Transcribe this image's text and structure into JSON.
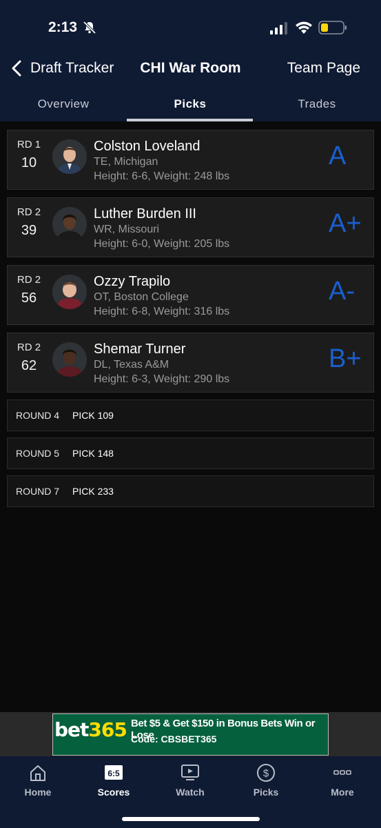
{
  "status": {
    "time": "2:13"
  },
  "nav": {
    "back_label": "Draft Tracker",
    "title": "CHI War Room",
    "right_label": "Team Page"
  },
  "tabs": [
    {
      "label": "Overview"
    },
    {
      "label": "Picks"
    },
    {
      "label": "Trades"
    }
  ],
  "picks": [
    {
      "round": "RD 1",
      "pick": "10",
      "name": "Colston Loveland",
      "position": "TE, Michigan",
      "measure": "Height: 6-6, Weight: 248 lbs",
      "grade": "A"
    },
    {
      "round": "RD 2",
      "pick": "39",
      "name": "Luther Burden III",
      "position": "WR, Missouri",
      "measure": "Height: 6-0, Weight: 205 lbs",
      "grade": "A+"
    },
    {
      "round": "RD 2",
      "pick": "56",
      "name": "Ozzy Trapilo",
      "position": "OT, Boston College",
      "measure": "Height: 6-8, Weight: 316 lbs",
      "grade": "A-"
    },
    {
      "round": "RD 2",
      "pick": "62",
      "name": "Shemar Turner",
      "position": "DL, Texas A&M",
      "measure": "Height: 6-3, Weight: 290 lbs",
      "grade": "B+"
    }
  ],
  "future_picks": [
    {
      "round": "ROUND 4",
      "pick": "PICK 109"
    },
    {
      "round": "ROUND 5",
      "pick": "PICK 148"
    },
    {
      "round": "ROUND 7",
      "pick": "PICK 233"
    }
  ],
  "ad": {
    "logo_white": "bet",
    "logo_yellow": "365",
    "headline": "Bet $5 & Get $150 in Bonus Bets Win or Lose",
    "code": "Code: CBSBET365"
  },
  "bottom_nav": [
    {
      "label": "Home",
      "icon": "home-icon"
    },
    {
      "label": "Scores",
      "icon": "scores-icon",
      "icon_text": "6:5"
    },
    {
      "label": "Watch",
      "icon": "watch-icon"
    },
    {
      "label": "Picks",
      "icon": "dollar-icon"
    },
    {
      "label": "More",
      "icon": "more-icon"
    }
  ],
  "colors": {
    "header_bg": "#0f1b33",
    "grade_blue": "#1a5fd0",
    "ad_green": "#05603d",
    "ad_yellow": "#ffdd00"
  }
}
